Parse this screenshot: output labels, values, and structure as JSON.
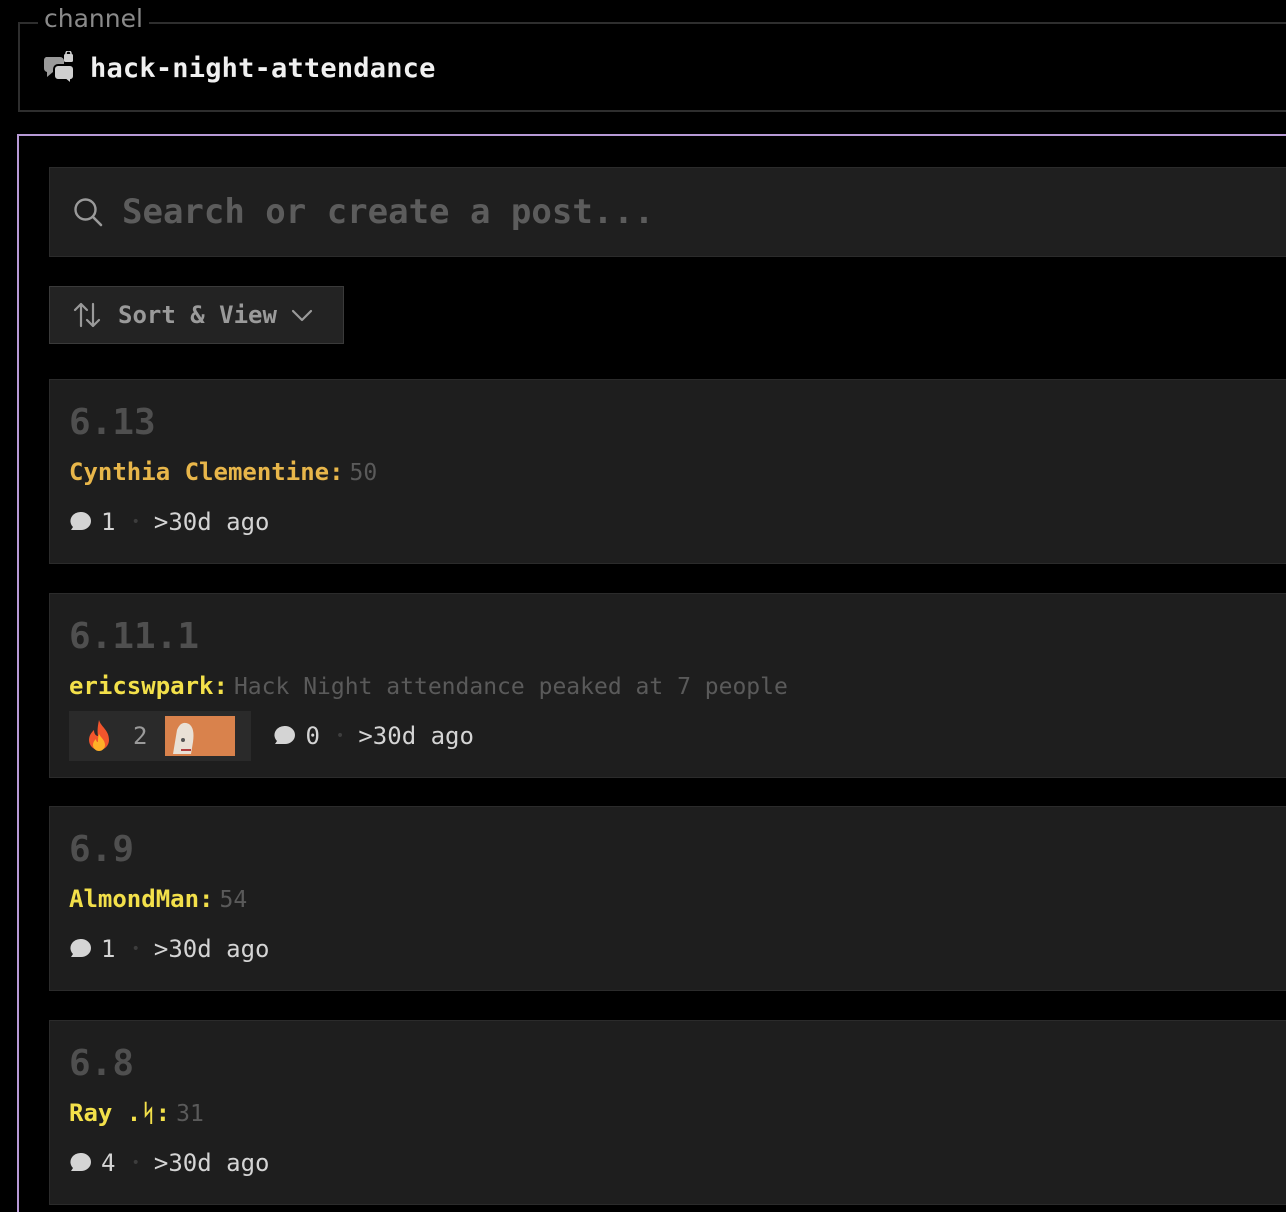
{
  "channel": {
    "legend": "channel",
    "name": "hack-night-attendance",
    "icon": "forum-icon"
  },
  "search": {
    "placeholder": "Search or create a post...",
    "icon": "search-icon"
  },
  "sort": {
    "label": "Sort & View",
    "icon": "sort-arrows-icon",
    "chevron": "chevron-down-icon"
  },
  "colors": {
    "panel_border": "#b79ad6",
    "author_orange": "#e8b64a",
    "author_yellow": "#f3e04a"
  },
  "posts": [
    {
      "title": "6.13",
      "author": "Cynthia Clementine",
      "author_color": "#e8b64a",
      "preview": "50",
      "comments": "1",
      "time": ">30d ago"
    },
    {
      "title": "6.11.1",
      "author": "ericswpark",
      "author_color": "#f3e04a",
      "preview": "Hack Night attendance peaked at 7 people",
      "reaction_emoji": "fire-icon",
      "reaction_count": "2",
      "comments": "0",
      "time": ">30d ago"
    },
    {
      "title": "6.9",
      "author": "AlmondMan",
      "author_color": "#f3e04a",
      "preview": "54",
      "comments": "1",
      "time": ">30d ago"
    },
    {
      "title": "6.8",
      "author": "Ray .ᛋ",
      "author_color": "#f3e04a",
      "preview": "31",
      "comments": "4",
      "time": ">30d ago"
    }
  ]
}
